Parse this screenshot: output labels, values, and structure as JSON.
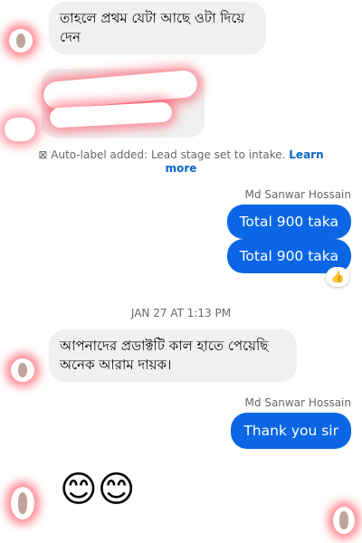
{
  "messages": {
    "incoming_1": "তাহলে প্রথম যেটা আছে ওটা দিয়ে দেন",
    "notice_text": "Auto-label added: Lead stage set to intake. ",
    "notice_link": "Learn more",
    "sender_1": "Md Sanwar Hossain",
    "outgoing_1": "Total 900 taka",
    "outgoing_2": "Total 900 taka",
    "reaction_icon": "thumbs-up",
    "reaction_glyph": "👍",
    "timestamp": "JAN 27 AT 1:13 PM",
    "incoming_2": "আপনাদের প্রডাক্টটি কাল হাতে পেয়েছি অনেক আরাম দায়ক।",
    "sender_2": "Md Sanwar Hossain",
    "outgoing_3": "Thank you sir",
    "emojis": "😊😊"
  },
  "colors": {
    "outgoing_bubble": "#0a66e4",
    "incoming_bubble": "#f0f0f0",
    "link": "#0a66c2",
    "meta_text": "#65676b"
  }
}
